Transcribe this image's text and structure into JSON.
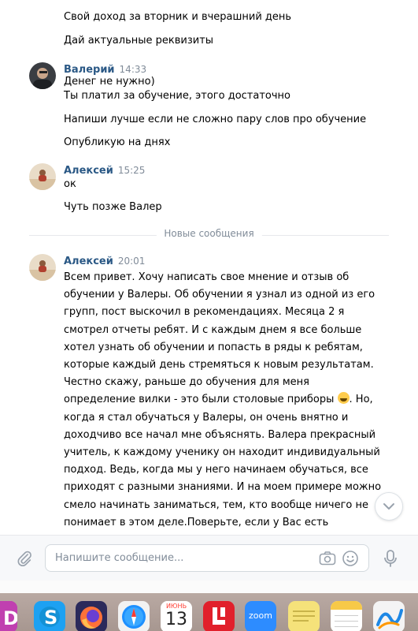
{
  "messages": {
    "top_lines": [
      "Свой доход за вторник и вчерашний день",
      "Дай актуальные реквизиты"
    ],
    "valery": {
      "name": "Валерий",
      "time": "14:33",
      "lines": [
        "Денег не нужно)",
        "Ты платил за обучение, этого достаточно",
        "Напиши лучше если не сложно пару слов про обучение",
        "Опубликую на днях"
      ]
    },
    "alexey_1": {
      "name": "Алексей",
      "time": "15:25",
      "lines": [
        "ок",
        "Чуть позже Валер"
      ]
    },
    "divider_label": "Новые сообщения",
    "alexey_2": {
      "name": "Алексей",
      "time": "20:01",
      "text_part1": "Всем привет. Хочу написать свое мнение и отзыв об обучении у Валеры. Об обучении я узнал из одной из его групп, пост выскочил в рекомендациях. Месяца 2 я смотрел отчеты ребят. И с каждым днем я все больше хотел узнать об обучении и попасть в ряды к ребятам, которые каждый день стремяться к новым результатам. Честно скажу, раньше до обучения для меня определение вилки - это были столовые приборы",
      "text_part2": ". Но, когда я стал обучаться у Валеры, он очень внятно и доходчиво все начал мне объяснять. Валера прекрасный учитель, к каждому ученику он находит индивидуальный подход. Ведь, когда мы у него начинаем обучаться, все приходят с разными знаниями. И на моем примере можно смело начинать заниматься, тем, кто вообще ничего не понимает в этом деле.Поверьте, если у Вас есть желание, то Валера это тот человек, наставник, учитель, который Вас обучит,научит и поможет во всем разобраться и начать зарабатывать. Если Вас интересует доход 10-15к в день минимум,то вы находитесь в правильном месте. Осталось сделать один шаг"
    }
  },
  "composer": {
    "placeholder": "Напишите сообщение..."
  },
  "dock": {
    "calendar_month": "ИЮНЬ",
    "calendar_day": "13",
    "zoom_label": "zoom",
    "apps": [
      "app-d-icon",
      "skype-icon",
      "firefox-icon",
      "safari-icon",
      "calendar-icon",
      "app-l-icon",
      "zoom-icon",
      "stickies-icon",
      "notes-icon",
      "freeform-icon"
    ]
  },
  "colors": {
    "author_name": "#2a5885",
    "timestamp": "#818c99",
    "divider": "#e7e8ec"
  }
}
